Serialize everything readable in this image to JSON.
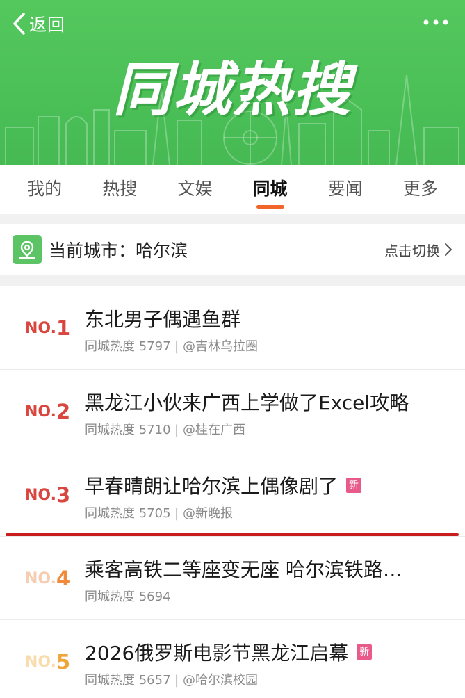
{
  "header": {
    "back_label": "返回",
    "banner_title": "同城热搜"
  },
  "tabs": [
    {
      "label": "我的",
      "active": false
    },
    {
      "label": "热搜",
      "active": false
    },
    {
      "label": "文娱",
      "active": false
    },
    {
      "label": "同城",
      "active": true
    },
    {
      "label": "要闻",
      "active": false
    },
    {
      "label": "更多",
      "active": false
    }
  ],
  "city": {
    "label": "当前城市：哈尔滨",
    "switch_label": "点击切换"
  },
  "items": [
    {
      "no": "NO.",
      "rank": "1",
      "title": "东北男子偶遇鱼群",
      "meta": "同城热度 5797 | @吉林乌拉圈",
      "badge": ""
    },
    {
      "no": "NO.",
      "rank": "2",
      "title": "黑龙江小伙来广西上学做了Excel攻略",
      "meta": "同城热度 5710 | @桂在广西",
      "badge": ""
    },
    {
      "no": "NO.",
      "rank": "3",
      "title": "早春晴朗让哈尔滨上偶像剧了",
      "meta": "同城热度 5705 | @新晚报",
      "badge": "新"
    },
    {
      "no": "NO.",
      "rank": "4",
      "title": "乘客高铁二等座变无座 哈尔滨铁路…",
      "meta": "同城热度 5694",
      "badge": ""
    },
    {
      "no": "NO.",
      "rank": "5",
      "title": "2026俄罗斯电影节黑龙江启幕",
      "meta": "同城热度 5657 | @哈尔滨校园",
      "badge": "新"
    }
  ],
  "colors": {
    "banner_green": "#4bc057",
    "tab_underline": "#f2652a",
    "rank_top3": "#d9463f",
    "rank_4_no": "#f6cdb2",
    "rank_4_num": "#f08a3c",
    "rank_5_no": "#f8dcae",
    "rank_5_num": "#f0a53a",
    "badge_new": "#e85a8a",
    "separator_line": "#c81e1e"
  },
  "icons": {
    "back": "chevron-left-icon",
    "more": "more-dots-icon",
    "city": "location-pin-icon",
    "switch": "chevron-right-icon"
  }
}
